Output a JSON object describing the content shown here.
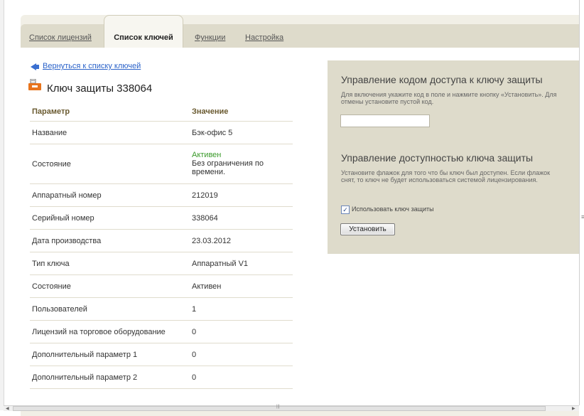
{
  "tabs": [
    {
      "label": "Список лицензий",
      "active": false
    },
    {
      "label": "Список ключей",
      "active": true
    },
    {
      "label": "Функции",
      "active": false
    },
    {
      "label": "Настройка",
      "active": false
    }
  ],
  "back_link": "Вернуться к списку ключей",
  "key_title": "Ключ защиты 338064",
  "table": {
    "header": {
      "param": "Параметр",
      "value": "Значение"
    },
    "rows": [
      {
        "param": "Название",
        "value": "Бэк-офис 5"
      },
      {
        "param": "Состояние",
        "status": "Активен",
        "value": "Без ограничения по времени."
      },
      {
        "param": "Аппаратный номер",
        "value": "212019"
      },
      {
        "param": "Серийный номер",
        "value": "338064"
      },
      {
        "param": "Дата производства",
        "value": "23.03.2012"
      },
      {
        "param": "Тип ключа",
        "value": "Аппаратный V1"
      },
      {
        "param": "Состояние",
        "value": "Активен"
      },
      {
        "param": "Пользователей",
        "value": "1"
      },
      {
        "param": "Лицензий на торговое оборудование",
        "value": "0"
      },
      {
        "param": "Дополнительный параметр 1",
        "value": "0"
      },
      {
        "param": "Дополнительный параметр 2",
        "value": "0"
      }
    ]
  },
  "access_code": {
    "heading": "Управление кодом доступа к ключу защиты",
    "text": "Для включения укажите код в поле и нажмите кнопку «Установить». Для отмены установите пустой код.",
    "input_value": ""
  },
  "availability": {
    "heading": "Управление доступностью ключа защиты",
    "text": "Установите флажок для того что бы ключ был доступен. Если флажок снят, то ключ не будет использоваться системой лицензирования.",
    "checkbox_label": "Использовать ключ защиты",
    "checkbox_checked": true,
    "check_mark": "✓",
    "button_label": "Установить"
  },
  "colors": {
    "tab_bar": "#dedbcb",
    "link": "#2a62c9",
    "active_status": "#3a9a2a",
    "header_text": "#6a5a30"
  }
}
